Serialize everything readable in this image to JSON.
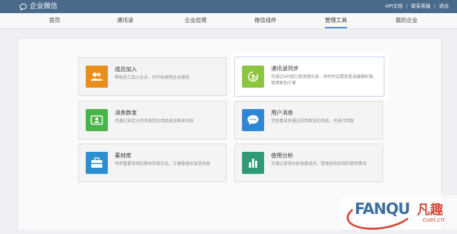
{
  "header": {
    "app_title": "企业微信",
    "links": [
      "API文档",
      "联系客服",
      "退出"
    ],
    "separator": "|"
  },
  "nav": {
    "items": [
      {
        "label": "首页"
      },
      {
        "label": "通讯录"
      },
      {
        "label": "企业应用"
      },
      {
        "label": "微信插件"
      },
      {
        "label": "管理工具",
        "active": true
      },
      {
        "label": "我的企业"
      }
    ]
  },
  "tools": [
    {
      "title": "成员加入",
      "desc": "帮助员工加入企业，并开始使用企业微信",
      "icon": "people-icon",
      "color": "#e98d1b"
    },
    {
      "title": "通讯录同步",
      "desc": "可通过API接口管理通讯录，同时可设置查看或编辑权限，管理更加方便",
      "icon": "sync-icon",
      "color": "#8cc63e",
      "highlighted": true
    },
    {
      "title": "消息群发",
      "desc": "可通过自定义的消息型应用给成员群发消息",
      "icon": "contacts-icon",
      "color": "#49b44a"
    },
    {
      "title": "用户消息",
      "desc": "可查看成员通过应用发送的消息，并进行回复",
      "icon": "chat-icon",
      "color": "#2f86d6"
    },
    {
      "title": "素材库",
      "desc": "可将重要常用的素材存放在此，方便管理员发送消息",
      "icon": "briefcase-icon",
      "color": "#2c8fcf"
    },
    {
      "title": "使用分析",
      "desc": "可通过使用分析查看成员、管理员和应用的使用情况",
      "icon": "bar-chart-icon",
      "color": "#2f9a78"
    }
  ],
  "watermark": {
    "text": "FANQU",
    "cn": "凡趣",
    "sub": "cuel.cn"
  }
}
